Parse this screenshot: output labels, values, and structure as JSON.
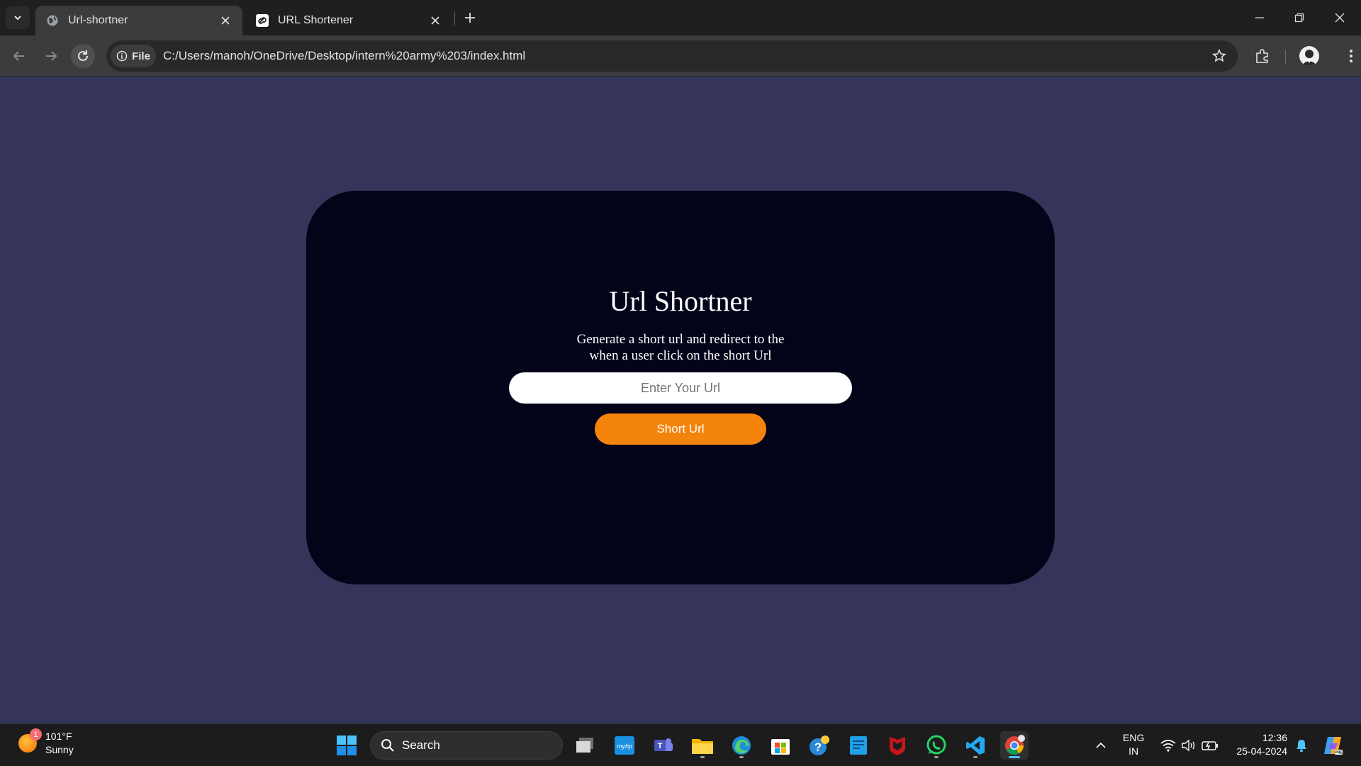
{
  "browser": {
    "tabs": [
      {
        "title": "Url-shortner",
        "active": true
      },
      {
        "title": "URL Shortener",
        "active": false
      }
    ],
    "address": {
      "chip_label": "File",
      "url": "C:/Users/manoh/OneDrive/Desktop/intern%20army%203/index.html"
    }
  },
  "page": {
    "title": "Url Shortner",
    "description": "Generate a short url and redirect to the when a user click on the short Url",
    "input_placeholder": "Enter Your Url",
    "button_label": "Short Url",
    "colors": {
      "background": "#35345a",
      "card": "#03031a",
      "accent": "#f5840c"
    }
  },
  "taskbar": {
    "weather": {
      "temperature": "101°F",
      "condition": "Sunny",
      "badge": "1"
    },
    "search_label": "Search",
    "apps": [
      "start-icon",
      "task-view-icon",
      "myhp-icon",
      "teams-icon",
      "file-explorer-icon",
      "edge-icon",
      "store-icon",
      "help-icon",
      "notepad-icon",
      "mcafee-icon",
      "whatsapp-icon",
      "vscode-icon",
      "chrome-icon"
    ],
    "language": {
      "line1": "ENG",
      "line2": "IN"
    },
    "clock": {
      "time": "12:36",
      "date": "25-04-2024"
    }
  }
}
